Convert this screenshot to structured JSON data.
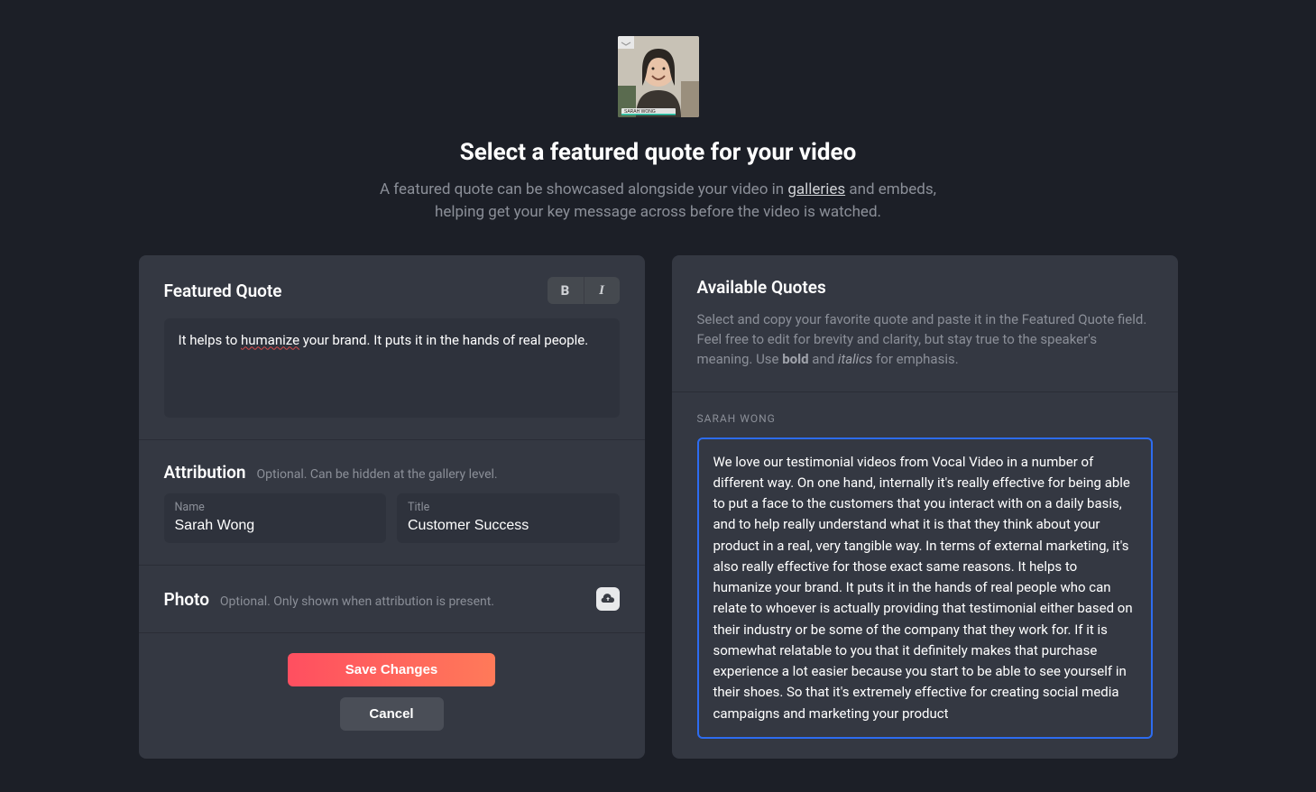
{
  "header": {
    "title": "Select a featured quote for your video",
    "desc_pre": "A featured quote can be showcased alongside your video in ",
    "desc_link": "galleries",
    "desc_post": " and embeds, helping get your key message across before the video is watched.",
    "thumbnail_caption": "SARAH WONG"
  },
  "featured_quote": {
    "section_title": "Featured Quote",
    "text_pre": "It helps to ",
    "text_underlined": "humanize",
    "text_post": " your brand. It puts it in the hands of real people."
  },
  "attribution": {
    "section_title": "Attribution",
    "hint": "Optional. Can be hidden at the gallery level.",
    "name_label": "Name",
    "name_value": "Sarah Wong",
    "title_label": "Title",
    "title_value": "Customer Success"
  },
  "photo": {
    "section_title": "Photo",
    "hint": "Optional. Only shown when attribution is present."
  },
  "actions": {
    "save": "Save Changes",
    "cancel": "Cancel"
  },
  "available": {
    "section_title": "Available Quotes",
    "desc_pre": "Select and copy your favorite quote and paste it in the Featured Quote field. Feel free to edit for brevity and clarity, but stay true to the speaker's meaning. Use ",
    "desc_bold": "bold",
    "desc_mid": " and ",
    "desc_italic": "italics",
    "desc_post": " for emphasis.",
    "speaker": "SARAH WONG",
    "quote": "We love our testimonial videos from Vocal Video in a number of different way. On one hand, internally it's really effective for being able to put a face to the customers that you interact with on a daily basis, and to help really understand what it is that they think about your product in a real, very tangible way. In terms of external marketing, it's also really effective for those exact same reasons. It helps to humanize your brand. It puts it in the hands of real people who can relate to whoever is actually providing that testimonial either based on their industry or be some of the company that they work for. If it is somewhat relatable to you that it definitely makes that purchase experience a lot easier because you start to be able to see yourself in their shoes. So that it's extremely effective for creating social media campaigns and marketing your product"
  },
  "format": {
    "bold_label": "B",
    "italic_label": "I"
  }
}
